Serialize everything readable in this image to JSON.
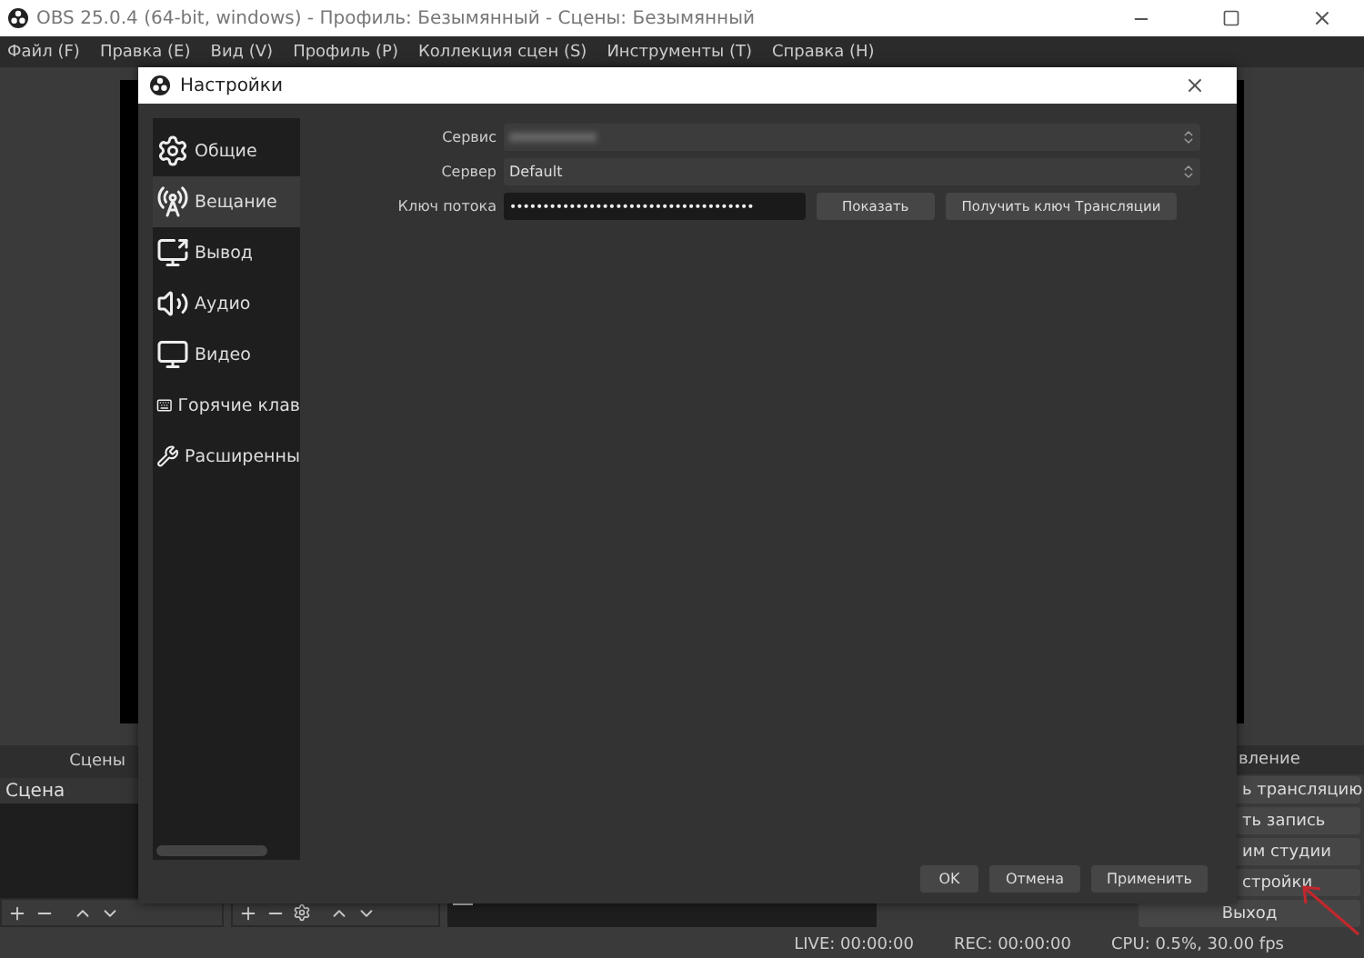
{
  "window": {
    "title": "OBS 25.0.4 (64-bit, windows) - Профиль: Безымянный - Сцены: Безымянный"
  },
  "menu": [
    "Файл (F)",
    "Правка (E)",
    "Вид (V)",
    "Профиль (P)",
    "Коллекция сцен (S)",
    "Инструменты (T)",
    "Справка (H)"
  ],
  "scenes": {
    "title": "Сцены",
    "items": [
      {
        "label": "Сцена",
        "selected": true
      }
    ]
  },
  "controls": {
    "title": "вление",
    "buttons": [
      {
        "label": "ь трансляцию",
        "cut": true
      },
      {
        "label": "ть запись",
        "cut": true
      },
      {
        "label": "им студии",
        "cut": true
      },
      {
        "label": "стройки",
        "cut": true
      },
      {
        "label": "Выход",
        "cut": false
      }
    ]
  },
  "status_bar": [
    "LIVE: 00:00:00",
    "REC: 00:00:00",
    "CPU: 0.5%, 30.00 fps"
  ],
  "dialog": {
    "title": "Настройки",
    "nav": [
      {
        "label": "Общие",
        "kind": "general",
        "selected": false
      },
      {
        "label": "Вещание",
        "kind": "stream",
        "selected": true
      },
      {
        "label": "Вывод",
        "kind": "output",
        "selected": false
      },
      {
        "label": "Аудио",
        "kind": "audio",
        "selected": false
      },
      {
        "label": "Видео",
        "kind": "video",
        "selected": false
      },
      {
        "label": "Горячие клав",
        "kind": "hotkeys",
        "selected": false
      },
      {
        "label": "Расширенны",
        "kind": "advanced",
        "selected": false
      }
    ],
    "form": [
      {
        "label": "Сервис",
        "kind": "select",
        "blurred": true
      },
      {
        "label": "Сервер",
        "kind": "select",
        "value": "Default"
      },
      {
        "label": "Ключ потока",
        "kind": "secret",
        "value": "•••••••••••••••••••••••••••••••••••••",
        "buttons": [
          "Показать",
          "Получить ключ Трансляции"
        ]
      }
    ],
    "buttons": [
      "OK",
      "Отмена",
      "Применить"
    ]
  }
}
